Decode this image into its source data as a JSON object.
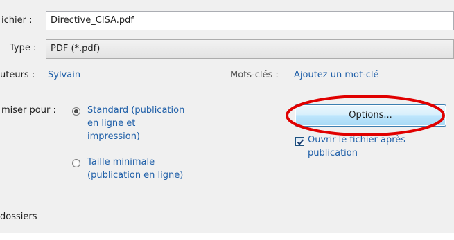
{
  "filename": {
    "label": "ichier :",
    "value": "Directive_CISA.pdf"
  },
  "filetype": {
    "label": "Type :",
    "value": "PDF (*.pdf)"
  },
  "authors": {
    "label": "uteurs :",
    "value": "Sylvain"
  },
  "keywords": {
    "label": "Mots-clés :",
    "value": "Ajoutez un mot-clé"
  },
  "optimize": {
    "label": "miser pour :",
    "options": [
      {
        "line1": "Standard (publication",
        "line2": "en ligne et",
        "line3": "impression)",
        "selected": true
      },
      {
        "line1": "Taille minimale",
        "line2": "(publication en ligne)",
        "selected": false
      }
    ]
  },
  "options_button": {
    "label": "Options..."
  },
  "open_after": {
    "line1": "Ouvrir le fichier après",
    "line2": "publication",
    "checked": true
  },
  "folders": {
    "label": "dossiers"
  },
  "colors": {
    "link": "#1f5fa8",
    "highlight": "#e00000"
  }
}
